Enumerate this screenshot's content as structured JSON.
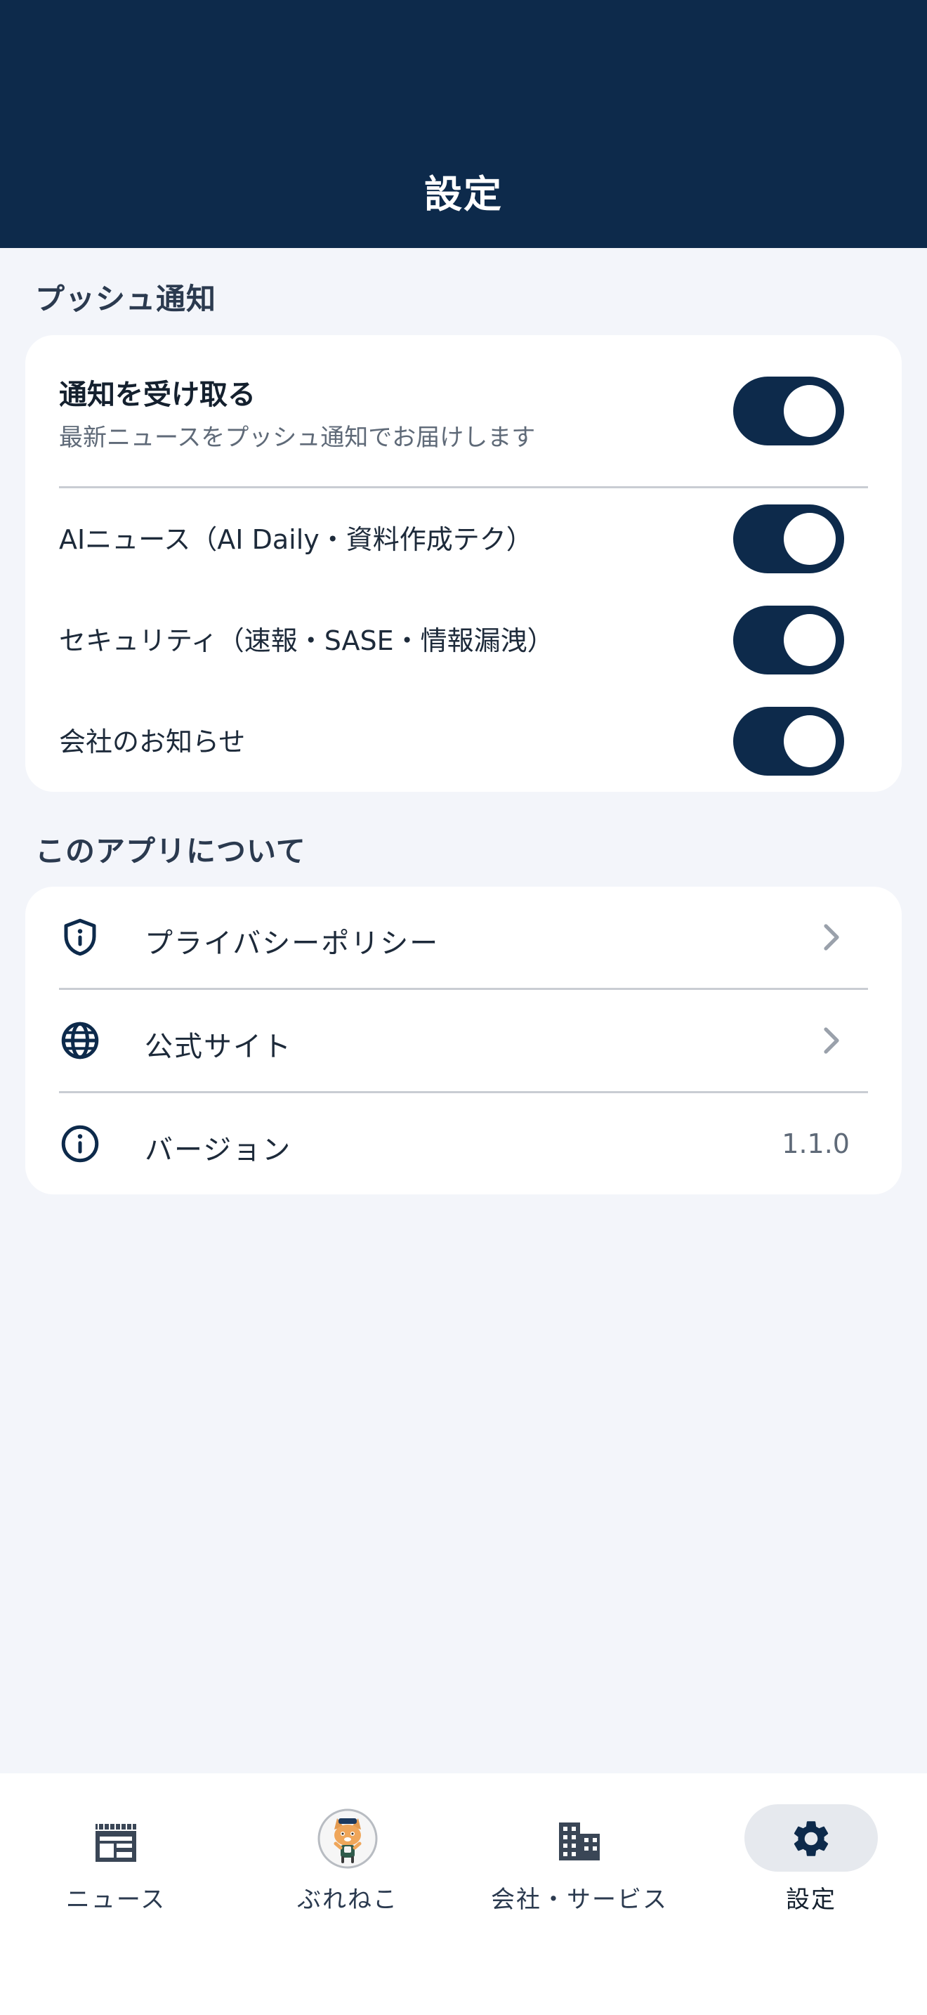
{
  "header": {
    "title": "設定"
  },
  "push_section": {
    "title": "プッシュ通知",
    "main": {
      "title": "通知を受け取る",
      "subtitle": "最新ニュースをプッシュ通知でお届けします",
      "enabled": true
    },
    "items": [
      {
        "label": "AIニュース（AI Daily・資料作成テク）",
        "enabled": true
      },
      {
        "label": "セキュリティ（速報・SASE・情報漏洩）",
        "enabled": true
      },
      {
        "label": "会社のお知らせ",
        "enabled": true
      }
    ]
  },
  "about_section": {
    "title": "このアプリについて",
    "items": [
      {
        "label": "プライバシーポリシー",
        "icon": "shield-icon"
      },
      {
        "label": "公式サイト",
        "icon": "globe-icon"
      },
      {
        "label": "バージョン",
        "icon": "info-icon",
        "value": "1.1.0"
      }
    ]
  },
  "tabs": [
    {
      "label": "ニュース",
      "icon": "newspaper-icon",
      "active": false
    },
    {
      "label": "ぶれねこ",
      "icon": "cat-avatar-icon",
      "active": false
    },
    {
      "label": "会社・サービス",
      "icon": "building-icon",
      "active": false
    },
    {
      "label": "設定",
      "icon": "gear-icon",
      "active": true
    }
  ],
  "colors": {
    "navy": "#0d2a4b",
    "background": "#f3f5fa",
    "card": "#ffffff"
  }
}
